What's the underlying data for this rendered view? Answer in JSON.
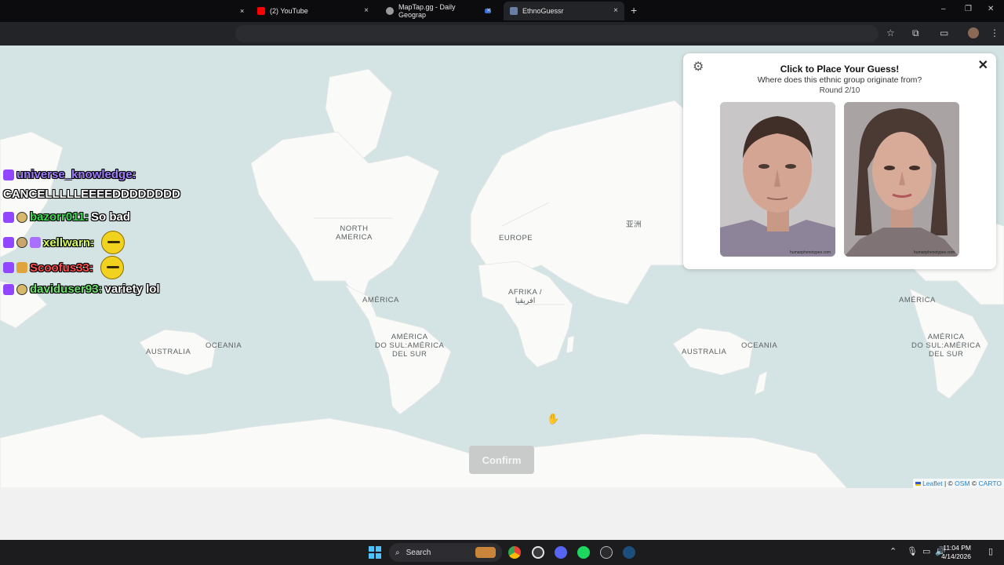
{
  "browser": {
    "tabs": [
      {
        "title": "(2) YouTube",
        "icon": "youtube-icon"
      },
      {
        "title": "MapTap.gg - Daily Geograp",
        "icon": "pin-icon"
      },
      {
        "title": "EthnoGuessr",
        "icon": "globe-icon"
      }
    ],
    "new_tab_symbol": "+",
    "close_symbol": "×"
  },
  "map": {
    "labels": {
      "north_america": "NORTH\nAMERICA",
      "europe": "EUROPE",
      "asia": "亚洲",
      "africa": "AFRIKA /\nافريقيا",
      "america_left": "AMÉRICA",
      "south_america_left": "AMÉRICA\nDO SUL:AMÉRICA\nDEL SUR",
      "australia_left": "AUSTRALIA",
      "oceania_left": "OCEANIA",
      "australia_right": "AUSTRALIA",
      "oceania_right": "OCEANIA",
      "america_right": "AMÉRICA",
      "south_america_right": "AMÉRICA\nDO SUL:AMÉRICA\nDEL SUR"
    },
    "attribution": {
      "leaflet": "Leaflet",
      "separator": " | © ",
      "osm": "OSM",
      "and": " © ",
      "carto": "CARTO"
    },
    "confirm_label": "Confirm"
  },
  "panel": {
    "title": "Click to Place Your Guess!",
    "subtitle": "Where does this ethnic group originate from?",
    "round": "Round 2/10",
    "watermark_left": "humanphenotypes.com",
    "watermark_right": "humanphenotypes.com"
  },
  "chat": {
    "partial_header": "universe_knowledge:",
    "messages": [
      {
        "user": "",
        "text": "CANCELLLLLEEEEDDDDDDDD",
        "user_color": "#ffffff"
      },
      {
        "user": "bazorr011:",
        "text": " So bad",
        "user_color": "#3cde52"
      },
      {
        "user": "xellwarn:",
        "text": "",
        "user_color": "#d9ff5c"
      },
      {
        "user": "Scoofus33:",
        "text": "",
        "user_color": "#ff4d4d"
      },
      {
        "user": "daviduser93:",
        "text": " variety lol",
        "user_color": "#6ce06c"
      }
    ]
  },
  "taskbar": {
    "search_label": "Search",
    "time": "11:04 PM",
    "date": "4/14/2026"
  },
  "colors": {
    "water": "#d4e3e4",
    "land": "#fafaf8",
    "accent_twitch": "#9146ff"
  }
}
